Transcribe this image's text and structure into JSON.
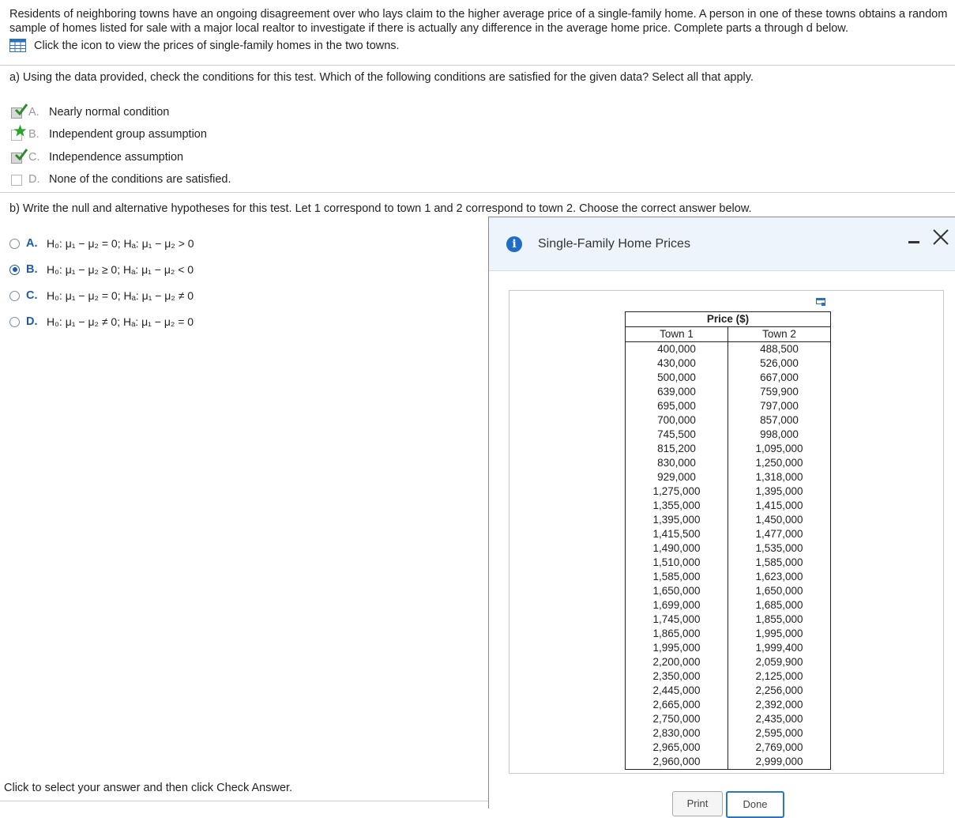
{
  "intro": "Residents of neighboring towns have an ongoing disagreement over who lays claim to the higher average price of a single-family home. A person in one of these towns obtains a random sample of homes listed for sale with a major local realtor to investigate if there is actually any difference in the average home price. Complete parts a through d below.",
  "table_link": "Click the icon to view the prices of single-family homes in the two towns.",
  "part_a": {
    "question": "a) Using the data provided, check the conditions for this test. Which of the following conditions are satisfied for the given data? Select all that apply.",
    "options": [
      {
        "letter": "A.",
        "text": "Nearly normal condition"
      },
      {
        "letter": "B.",
        "text": "Independent group assumption"
      },
      {
        "letter": "C.",
        "text": "Independence assumption"
      },
      {
        "letter": "D.",
        "text": "None of the conditions are satisfied."
      }
    ]
  },
  "part_b": {
    "question": "b) Write the null and alternative hypotheses for this test. Let 1 correspond to town 1 and 2 correspond to town 2. Choose the correct answer below.",
    "options": [
      {
        "letter": "A.",
        "text": "H₀: μ₁ − μ₂ = 0; Hₐ: μ₁ − μ₂ > 0"
      },
      {
        "letter": "B.",
        "text": "H₀: μ₁ − μ₂ ≥ 0; Hₐ: μ₁ − μ₂ < 0"
      },
      {
        "letter": "C.",
        "text": "H₀: μ₁ − μ₂ = 0; Hₐ: μ₁ − μ₂ ≠ 0"
      },
      {
        "letter": "D.",
        "text": "H₀: μ₁ − μ₂ ≠ 0; Hₐ: μ₁ − μ₂ = 0"
      }
    ],
    "selected": "B."
  },
  "footer": "Click to select your answer and then click Check Answer.",
  "popup": {
    "title": "Single-Family Home Prices",
    "table_header": "Price ($)",
    "col1": "Town 1",
    "col2": "Town 2",
    "town1": [
      "400,000",
      "430,000",
      "500,000",
      "639,000",
      "695,000",
      "700,000",
      "745,500",
      "815,200",
      "830,000",
      "929,000",
      "1,275,000",
      "1,355,000",
      "1,395,000",
      "1,415,500",
      "1,490,000",
      "1,510,000",
      "1,585,000",
      "1,650,000",
      "1,699,000",
      "1,745,000",
      "1,865,000",
      "1,995,000",
      "2,200,000",
      "2,350,000",
      "2,445,000",
      "2,665,000",
      "2,750,000",
      "2,830,000",
      "2,965,000",
      "2,960,000"
    ],
    "town2": [
      "488,500",
      "526,000",
      "667,000",
      "759,900",
      "797,000",
      "857,000",
      "998,000",
      "1,095,000",
      "1,250,000",
      "1,318,000",
      "1,395,000",
      "1,415,000",
      "1,450,000",
      "1,477,000",
      "1,535,000",
      "1,585,000",
      "1,623,000",
      "1,650,000",
      "1,685,000",
      "1,855,000",
      "1,995,000",
      "1,999,400",
      "2,059,900",
      "2,125,000",
      "2,256,000",
      "2,392,000",
      "2,435,000",
      "2,595,000",
      "2,769,000",
      "2,999,000"
    ],
    "print_label": "Print",
    "done_label": "Done"
  },
  "colors": {
    "accent": "#1f5aa5",
    "check": "#2e8b2e",
    "star": "#2aa52a",
    "header_bg": "#eef4fc"
  }
}
